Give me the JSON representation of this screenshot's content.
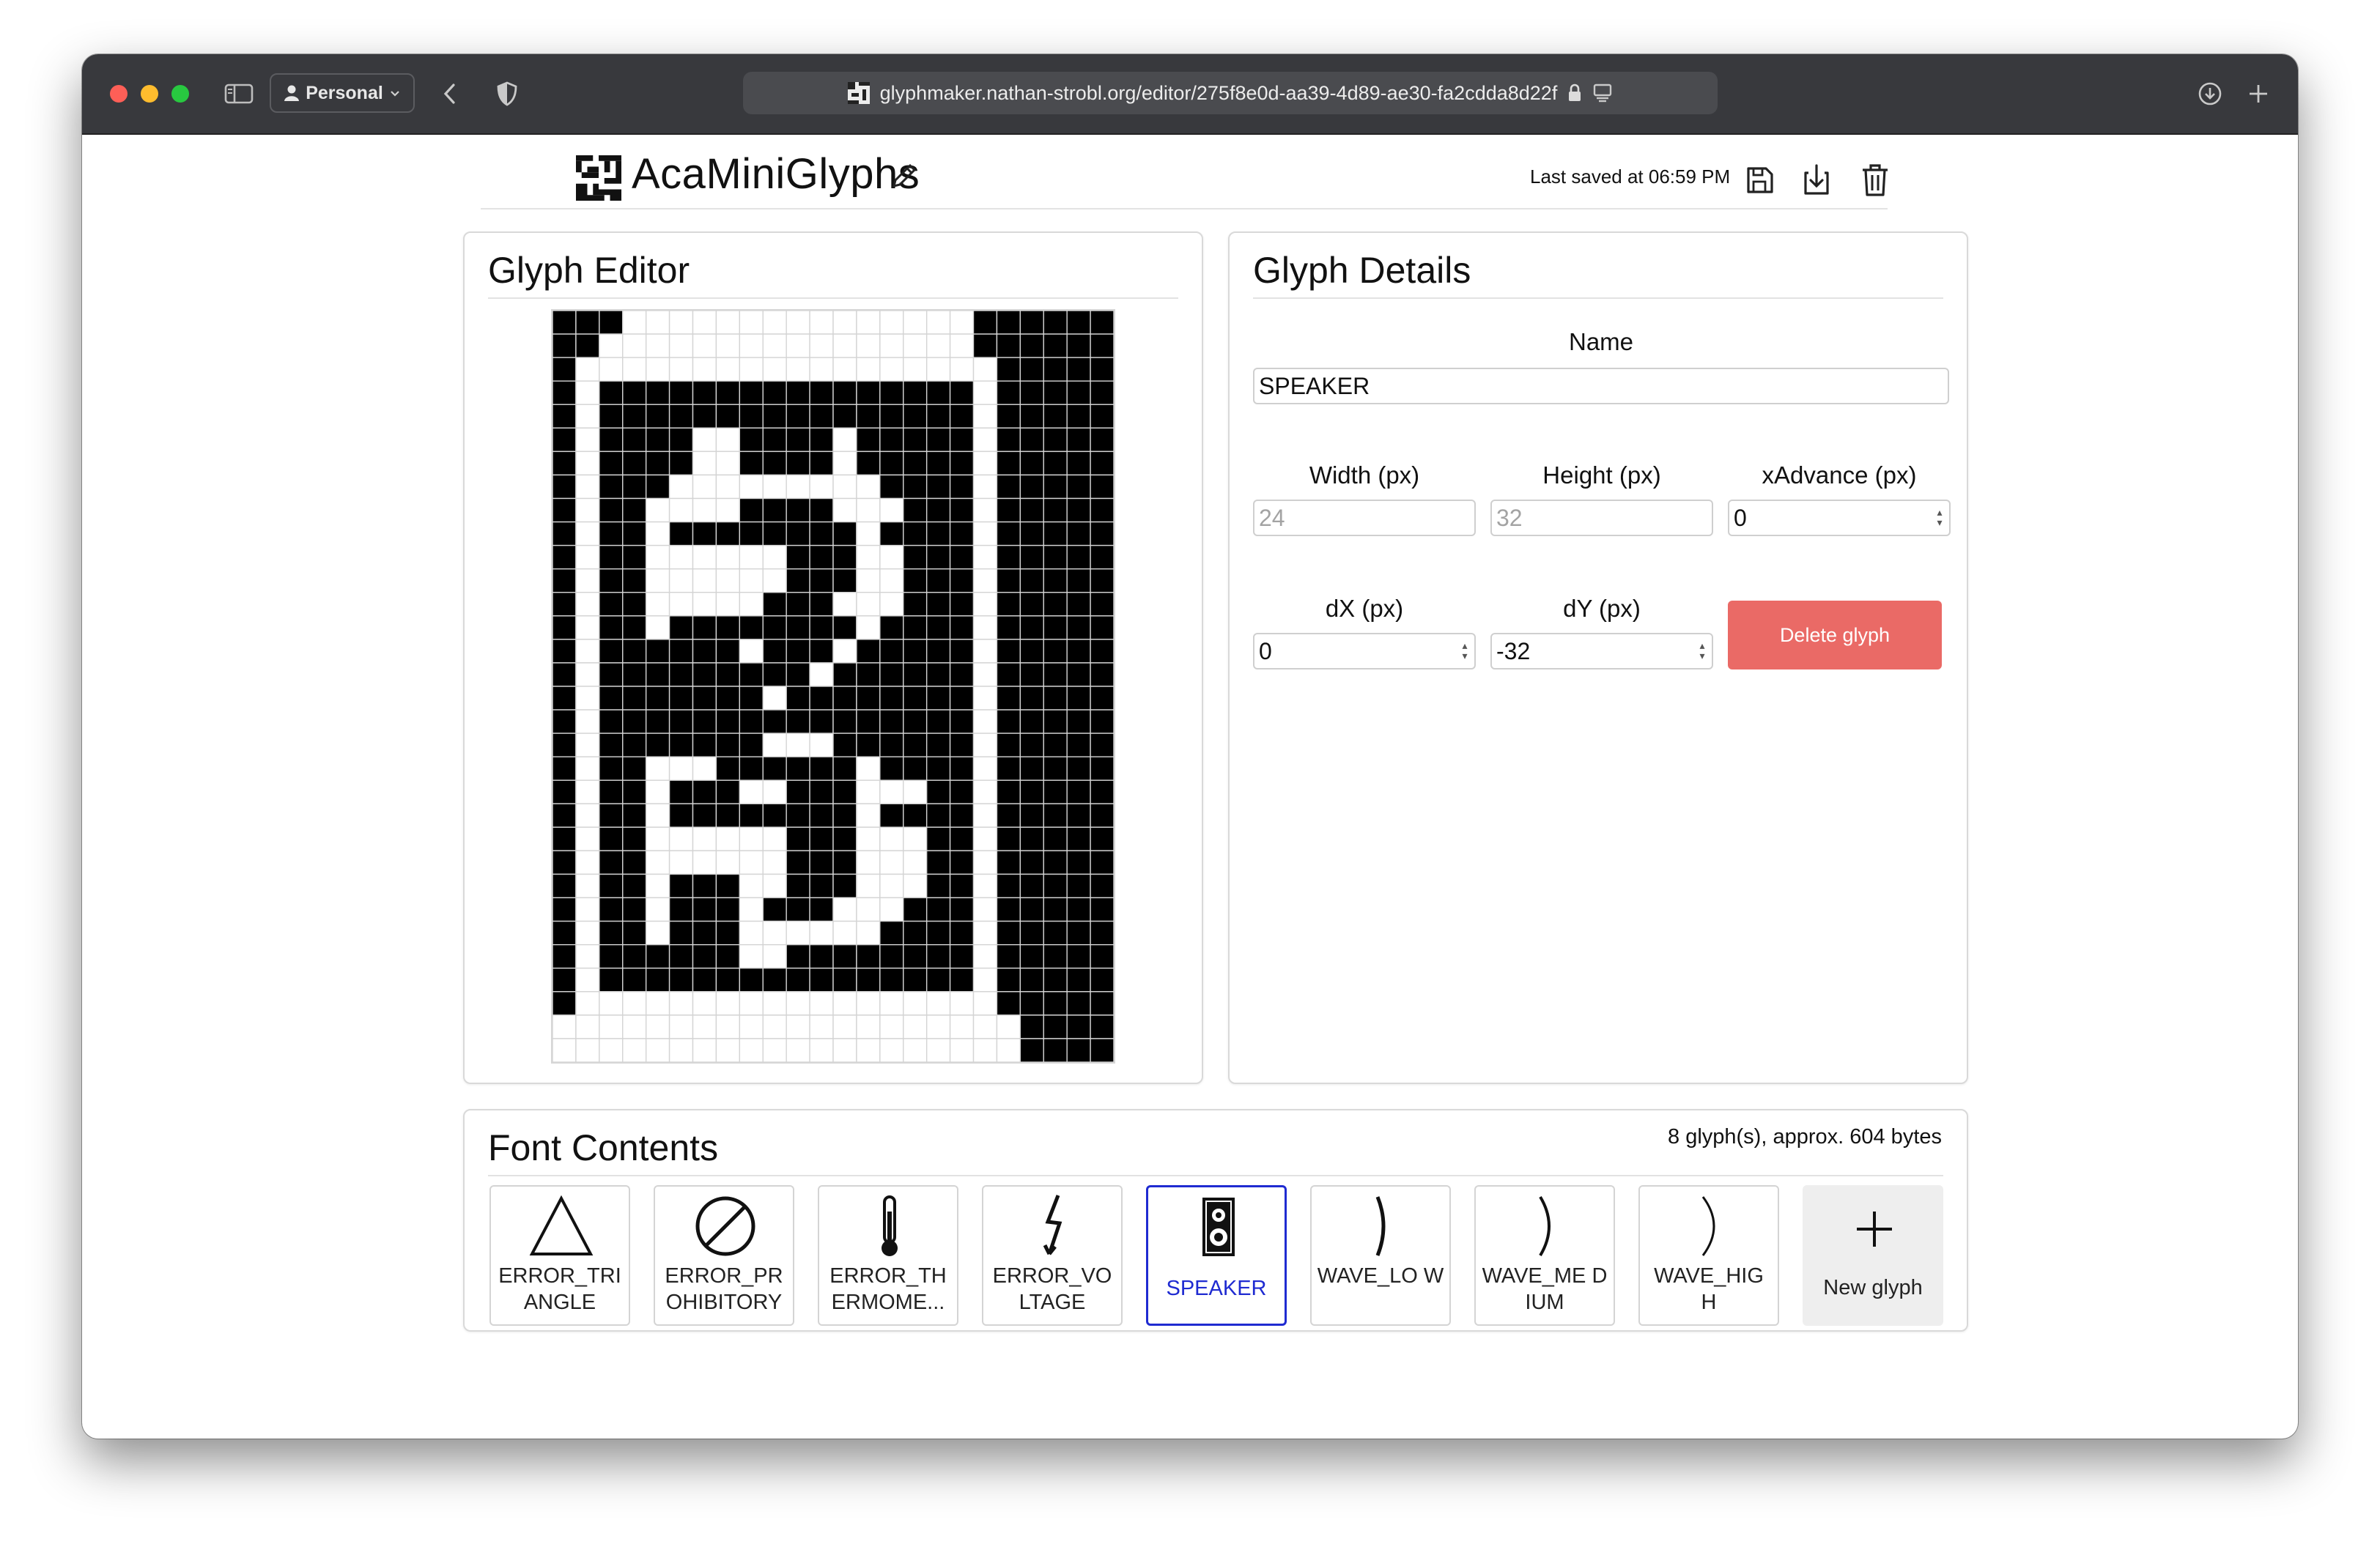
{
  "browser": {
    "profile_label": "Personal",
    "url": "glyphmaker.nathan-strobl.org/editor/275f8e0d-aa39-4d89-ae30-fa2cdda8d22f"
  },
  "header": {
    "title": "AcaMiniGlyphs",
    "last_saved": "Last saved at 06:59 PM"
  },
  "editor": {
    "title": "Glyph Editor",
    "grid_cols": 24,
    "grid_rows": 32,
    "pixels": [
      "111000000000000000111111",
      "110000000000000000111111",
      "100000000000000000011111",
      "101111111111111111011111",
      "101111111111111111011111",
      "101111001111011111011111",
      "101111001111011111011111",
      "101110000000001111011111",
      "101100001111000111011111",
      "101101111111101111011111",
      "101100000011100111011111",
      "101100000011100111011111",
      "101100000111000111011111",
      "101101111111101111011111",
      "101111110111011111011111",
      "101111111110111111011111",
      "101111111011111111011111",
      "101111111111111111011111",
      "101111111000111111011111",
      "101100011111101111011111",
      "101101110011100011011111",
      "101101111111101111011111",
      "101100000011100011011111",
      "101100000011100011011111",
      "101101110011100011011111",
      "101101110111000111011111",
      "101101110000001111011111",
      "101111110011111111011111",
      "101111111111111111011111",
      "100000000000000000011111",
      "000000000000000000001111",
      "000000000000000000001111"
    ]
  },
  "details": {
    "title": "Glyph Details",
    "name_label": "Name",
    "name_value": "SPEAKER",
    "width_label": "Width (px)",
    "width_value": "24",
    "height_label": "Height (px)",
    "height_value": "32",
    "xadvance_label": "xAdvance (px)",
    "xadvance_value": "0",
    "dx_label": "dX (px)",
    "dx_value": "0",
    "dy_label": "dY (px)",
    "dy_value": "-32",
    "delete_label": "Delete glyph"
  },
  "contents": {
    "title": "Font Contents",
    "summary": "8 glyph(s), approx. 604 bytes",
    "glyphs": [
      {
        "label": "ERROR_TRI ANGLE",
        "icon": "triangle-icon"
      },
      {
        "label": "ERROR_PR OHIBITORY",
        "icon": "prohibitory-icon"
      },
      {
        "label": "ERROR_TH ERMOME...",
        "icon": "thermometer-icon"
      },
      {
        "label": "ERROR_VO LTAGE",
        "icon": "lightning-icon"
      },
      {
        "label": "SPEAKER",
        "icon": "speaker-icon",
        "selected": true
      },
      {
        "label": "WAVE_LO W",
        "icon": "wave-low-icon"
      },
      {
        "label": "WAVE_ME DIUM",
        "icon": "wave-medium-icon"
      },
      {
        "label": "WAVE_HIG H",
        "icon": "wave-high-icon"
      }
    ],
    "new_glyph_label": "New glyph",
    "selected_color": "#1f2bd1",
    "delete_color": "#ea6a66"
  }
}
